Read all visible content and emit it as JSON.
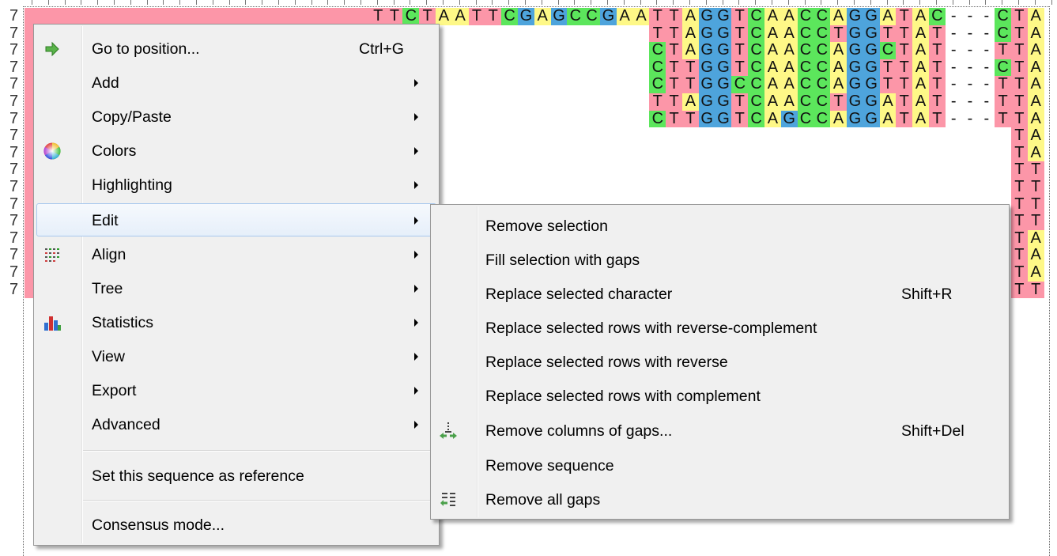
{
  "alignment": {
    "row_labels": [
      "7",
      "7",
      "7",
      "7",
      "7",
      "7",
      "7",
      "7",
      "7",
      "7",
      "7",
      "7",
      "7",
      "7",
      "7",
      "7",
      "7"
    ],
    "rows": [
      "TTCTAATTCGAGCCGAATTAGGTCAACCAGGATAC---CTA",
      "...................TTAGGTCAACCTGGTTAT---CTA",
      "...................CTAGGTCAACCAGGCTAT---TTA",
      "...................CTTGGTCAACCAGGTTAT---CTA",
      "...................CTTGGCCAACCAGGTTAT---TTA",
      "...................TTAGGTCAACCTGGATAT---TTA",
      "...................CTTGGTCAGCCAGGATAT---TTA",
      "..........................................TA",
      "..........................................TA",
      "..........................................TT",
      "..........................................TT",
      "..........................................TT",
      "..........................................TT",
      "..........................................TA",
      "..........................................TA",
      "..........................................TA",
      "..........................................TT"
    ],
    "base_colors": {
      "A": "#fef887",
      "C": "#5ce65c",
      "G": "#4ea4dc",
      "T": "#fc96a8",
      "-": "#ffffff"
    }
  },
  "context_menu": {
    "items": [
      {
        "label": "Go to position...",
        "shortcut": "Ctrl+G",
        "submenu": false,
        "icon": "arrow-right-icon"
      },
      {
        "label": "Add",
        "shortcut": "",
        "submenu": true,
        "icon": ""
      },
      {
        "label": "Copy/Paste",
        "shortcut": "",
        "submenu": true,
        "icon": ""
      },
      {
        "label": "Colors",
        "shortcut": "",
        "submenu": true,
        "icon": "color-wheel-icon"
      },
      {
        "label": "Highlighting",
        "shortcut": "",
        "submenu": true,
        "icon": ""
      },
      {
        "label": "Edit",
        "shortcut": "",
        "submenu": true,
        "icon": "",
        "highlighted": true
      },
      {
        "label": "Align",
        "shortcut": "",
        "submenu": true,
        "icon": "align-icon"
      },
      {
        "label": "Tree",
        "shortcut": "",
        "submenu": true,
        "icon": ""
      },
      {
        "label": "Statistics",
        "shortcut": "",
        "submenu": true,
        "icon": "bar-chart-icon"
      },
      {
        "label": "View",
        "shortcut": "",
        "submenu": true,
        "icon": ""
      },
      {
        "label": "Export",
        "shortcut": "",
        "submenu": true,
        "icon": ""
      },
      {
        "label": "Advanced",
        "shortcut": "",
        "submenu": true,
        "icon": ""
      },
      {
        "label": "Set this sequence as reference",
        "shortcut": "",
        "submenu": false,
        "icon": ""
      },
      {
        "label": "Consensus mode...",
        "shortcut": "",
        "submenu": false,
        "icon": ""
      }
    ]
  },
  "edit_submenu": {
    "items": [
      {
        "label": "Remove selection",
        "shortcut": "",
        "icon": ""
      },
      {
        "label": "Fill selection with gaps",
        "shortcut": "",
        "icon": ""
      },
      {
        "label": "Replace selected character",
        "shortcut": "Shift+R",
        "icon": ""
      },
      {
        "label": "Replace selected rows with reverse-complement",
        "shortcut": "",
        "icon": ""
      },
      {
        "label": "Replace selected rows with reverse",
        "shortcut": "",
        "icon": ""
      },
      {
        "label": "Replace selected rows with complement",
        "shortcut": "",
        "icon": ""
      },
      {
        "label": "Remove columns of gaps...",
        "shortcut": "Shift+Del",
        "icon": "remove-gap-columns-icon"
      },
      {
        "label": "Remove sequence",
        "shortcut": "",
        "icon": ""
      },
      {
        "label": "Remove all gaps",
        "shortcut": "",
        "icon": "remove-all-gaps-icon"
      }
    ]
  }
}
